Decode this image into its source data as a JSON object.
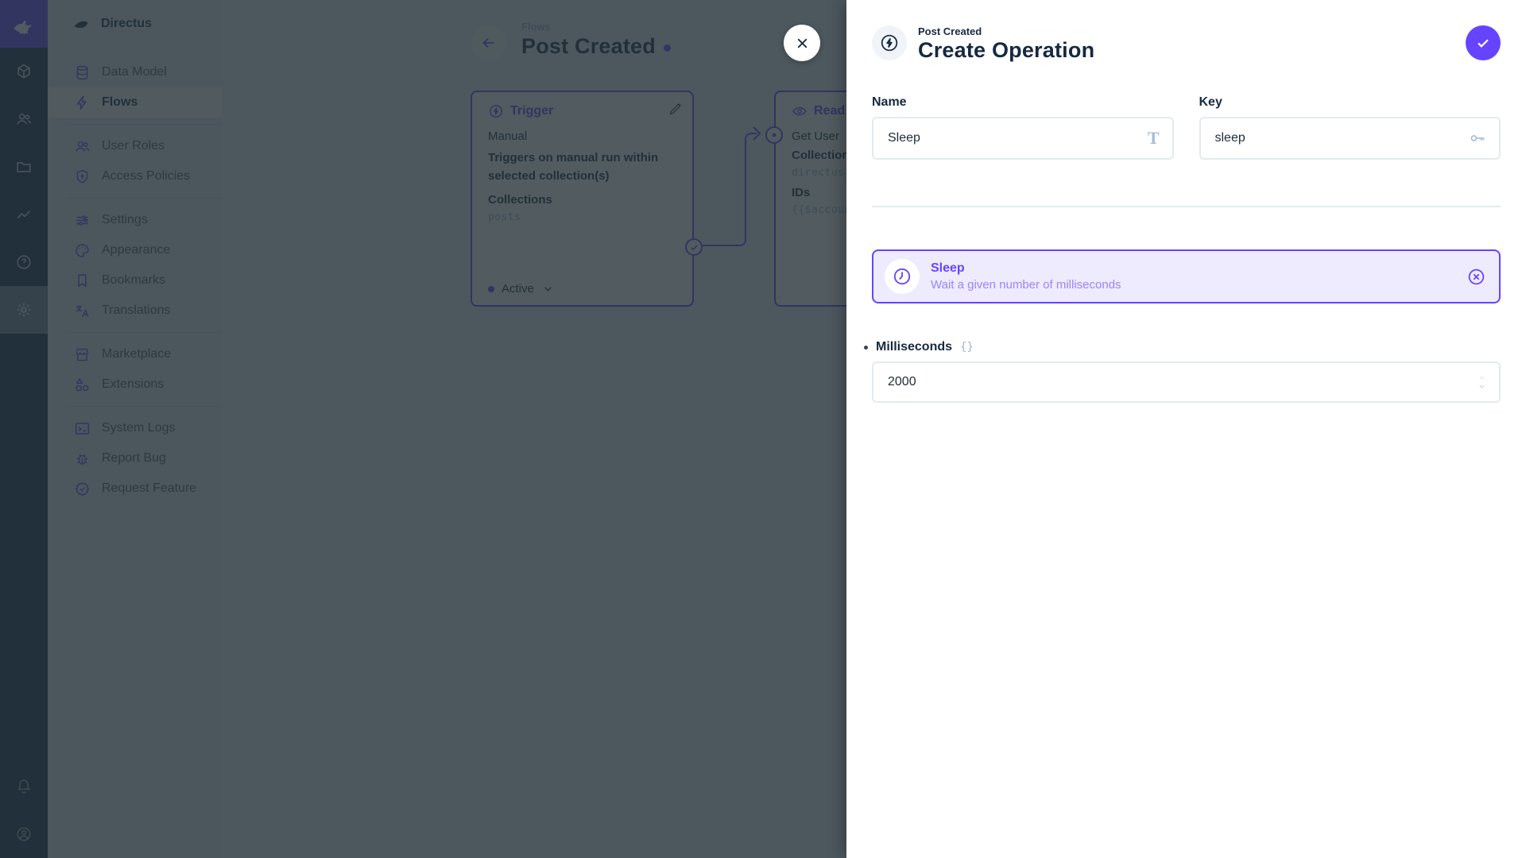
{
  "colors": {
    "accent": "#6644FF",
    "module_bar_bg": "#122842",
    "overlay": "rgba(38,50,56,0.8)",
    "danger": "#E35169",
    "drawer_bg": "#FFFFFF"
  },
  "sidebar": {
    "project_name": "Directus",
    "groups": [
      {
        "items": [
          {
            "label": "Data Model",
            "icon": "database-icon"
          },
          {
            "label": "Flows",
            "icon": "bolt-icon",
            "active": true
          }
        ]
      },
      {
        "items": [
          {
            "label": "User Roles",
            "icon": "people-icon"
          },
          {
            "label": "Access Policies",
            "icon": "shield-lock-icon"
          }
        ]
      },
      {
        "items": [
          {
            "label": "Settings",
            "icon": "tune-icon"
          },
          {
            "label": "Appearance",
            "icon": "palette-icon"
          },
          {
            "label": "Bookmarks",
            "icon": "bookmark-icon"
          },
          {
            "label": "Translations",
            "icon": "translate-icon"
          }
        ]
      },
      {
        "items": [
          {
            "label": "Marketplace",
            "icon": "storefront-icon"
          },
          {
            "label": "Extensions",
            "icon": "shapes-icon"
          }
        ]
      },
      {
        "items": [
          {
            "label": "System Logs",
            "icon": "terminal-icon"
          },
          {
            "label": "Report Bug",
            "icon": "bug-icon"
          },
          {
            "label": "Request Feature",
            "icon": "feature-badge-icon"
          }
        ]
      }
    ]
  },
  "flow_page": {
    "breadcrumb": "Flows",
    "title": "Post Created",
    "trigger_panel": {
      "title": "Trigger",
      "type": "Manual",
      "description": "Triggers on manual run within selected collection(s)",
      "collections_label": "Collections",
      "collections_value": "posts",
      "status_label": "Active"
    },
    "read_data_panel": {
      "title": "Read Data",
      "name": "Get User",
      "collection_label": "Collection",
      "collection_value": "directus_users",
      "ids_label": "IDs",
      "ids_value": "{{$accountability.user}}"
    }
  },
  "drawer": {
    "breadcrumb": "Post Created",
    "title": "Create Operation",
    "name_field": {
      "label": "Name",
      "value": "Sleep",
      "suffix_glyph": "T"
    },
    "key_field": {
      "label": "Key",
      "value": "sleep"
    },
    "selected_operation": {
      "name": "Sleep",
      "description": "Wait a given number of milliseconds"
    },
    "milliseconds_field": {
      "label": "Milliseconds",
      "raw_toggle_glyph": "{}",
      "value": "2000"
    }
  }
}
